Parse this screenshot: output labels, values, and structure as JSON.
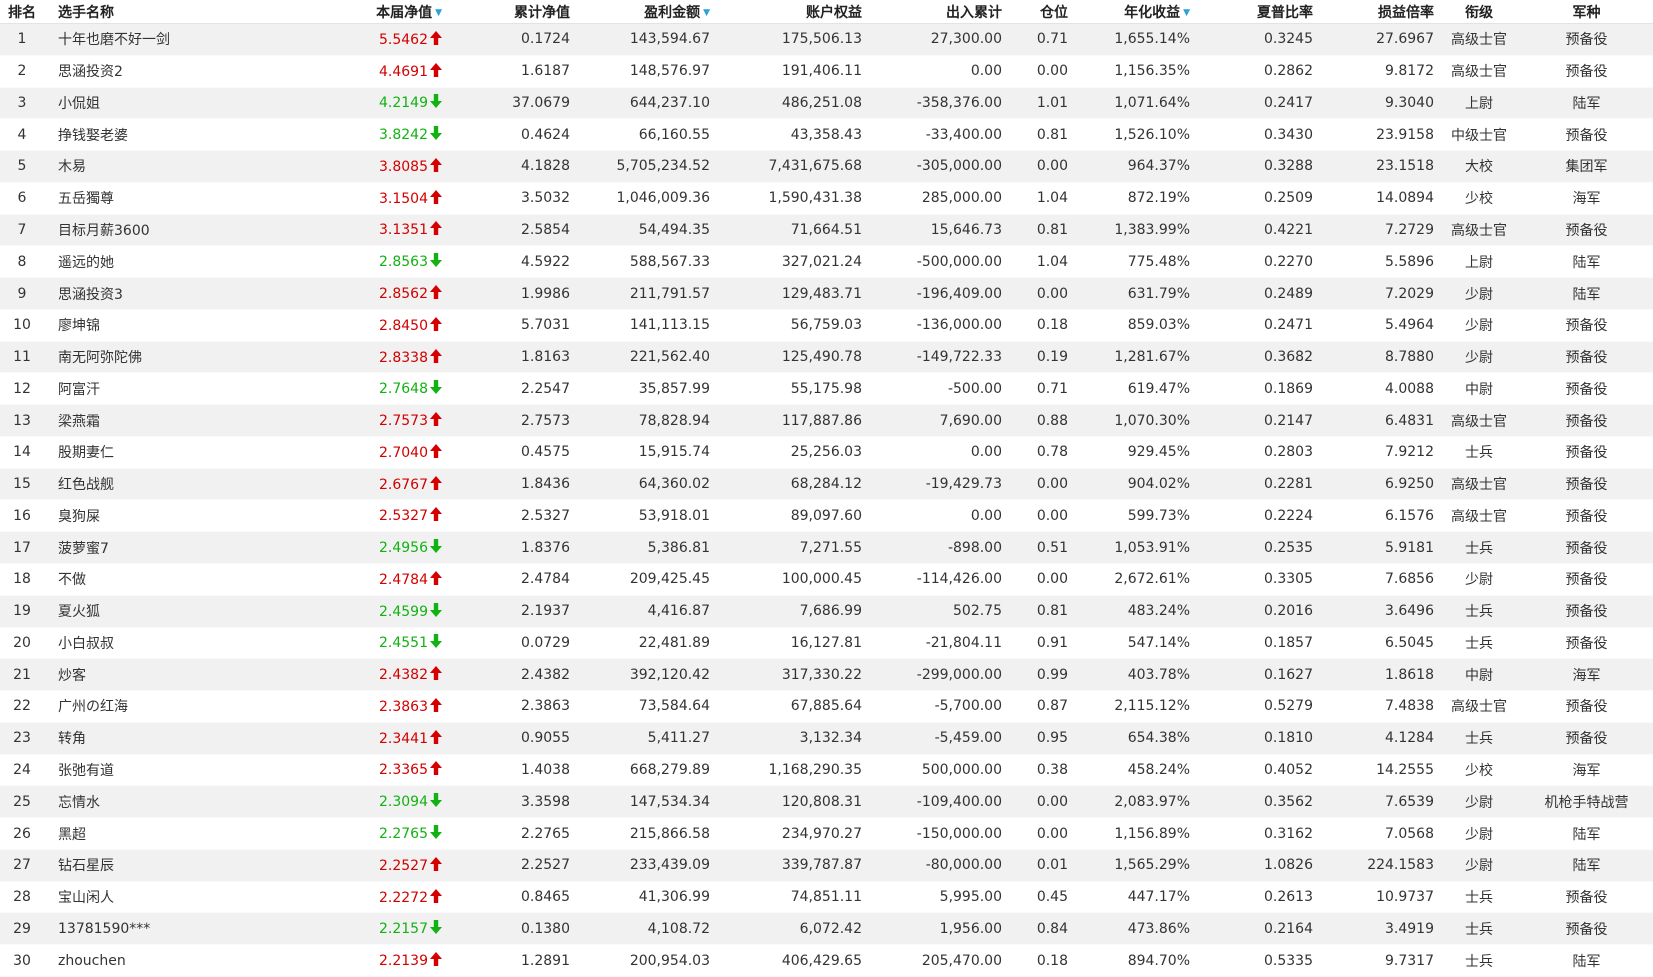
{
  "columns": {
    "rank": "排名",
    "name": "选手名称",
    "nav": "本届净值",
    "cum_nav": "累计净值",
    "profit": "盈利金额",
    "equity": "账户权益",
    "flow": "出入累计",
    "position": "仓位",
    "annual": "年化收益",
    "sharpe": "夏普比率",
    "pl_ratio": "损益倍率",
    "rank_title": "衔级",
    "army": "军种"
  },
  "sorted_columns": [
    "nav",
    "profit",
    "annual"
  ],
  "colors": {
    "up": "#d40000",
    "down": "#12b212",
    "sort": "#2aa0dc",
    "row_alt": "#f1f1f1"
  },
  "icons": {
    "up": "arrow-up-icon",
    "down": "arrow-down-icon",
    "sort": "sort-desc-icon"
  },
  "rows": [
    {
      "rank": "1",
      "name": "十年也磨不好一剑",
      "nav": "5.5462",
      "dir": "up",
      "cum_nav": "0.1724",
      "profit": "143,594.67",
      "equity": "175,506.13",
      "flow": "27,300.00",
      "position": "0.71",
      "annual": "1,655.14%",
      "sharpe": "0.3245",
      "pl_ratio": "27.6967",
      "rank_title": "高级士官",
      "army": "预备役"
    },
    {
      "rank": "2",
      "name": "思涵投资2",
      "nav": "4.4691",
      "dir": "up",
      "cum_nav": "1.6187",
      "profit": "148,576.97",
      "equity": "191,406.11",
      "flow": "0.00",
      "position": "0.00",
      "annual": "1,156.35%",
      "sharpe": "0.2862",
      "pl_ratio": "9.8172",
      "rank_title": "高级士官",
      "army": "预备役"
    },
    {
      "rank": "3",
      "name": "小侃姐",
      "nav": "4.2149",
      "dir": "down",
      "cum_nav": "37.0679",
      "profit": "644,237.10",
      "equity": "486,251.08",
      "flow": "-358,376.00",
      "position": "1.01",
      "annual": "1,071.64%",
      "sharpe": "0.2417",
      "pl_ratio": "9.3040",
      "rank_title": "上尉",
      "army": "陆军"
    },
    {
      "rank": "4",
      "name": "挣钱娶老婆",
      "nav": "3.8242",
      "dir": "down",
      "cum_nav": "0.4624",
      "profit": "66,160.55",
      "equity": "43,358.43",
      "flow": "-33,400.00",
      "position": "0.81",
      "annual": "1,526.10%",
      "sharpe": "0.3430",
      "pl_ratio": "23.9158",
      "rank_title": "中级士官",
      "army": "预备役"
    },
    {
      "rank": "5",
      "name": "木易",
      "nav": "3.8085",
      "dir": "up",
      "cum_nav": "4.1828",
      "profit": "5,705,234.52",
      "equity": "7,431,675.68",
      "flow": "-305,000.00",
      "position": "0.00",
      "annual": "964.37%",
      "sharpe": "0.3288",
      "pl_ratio": "23.1518",
      "rank_title": "大校",
      "army": "集团军"
    },
    {
      "rank": "6",
      "name": "五岳獨尊",
      "nav": "3.1504",
      "dir": "up",
      "cum_nav": "3.5032",
      "profit": "1,046,009.36",
      "equity": "1,590,431.38",
      "flow": "285,000.00",
      "position": "1.04",
      "annual": "872.19%",
      "sharpe": "0.2509",
      "pl_ratio": "14.0894",
      "rank_title": "少校",
      "army": "海军"
    },
    {
      "rank": "7",
      "name": "目标月薪3600",
      "nav": "3.1351",
      "dir": "up",
      "cum_nav": "2.5854",
      "profit": "54,494.35",
      "equity": "71,664.51",
      "flow": "15,646.73",
      "position": "0.81",
      "annual": "1,383.99%",
      "sharpe": "0.4221",
      "pl_ratio": "7.2729",
      "rank_title": "高级士官",
      "army": "预备役"
    },
    {
      "rank": "8",
      "name": "遥远的她",
      "nav": "2.8563",
      "dir": "down",
      "cum_nav": "4.5922",
      "profit": "588,567.33",
      "equity": "327,021.24",
      "flow": "-500,000.00",
      "position": "1.04",
      "annual": "775.48%",
      "sharpe": "0.2270",
      "pl_ratio": "5.5896",
      "rank_title": "上尉",
      "army": "陆军"
    },
    {
      "rank": "9",
      "name": "思涵投资3",
      "nav": "2.8562",
      "dir": "up",
      "cum_nav": "1.9986",
      "profit": "211,791.57",
      "equity": "129,483.71",
      "flow": "-196,409.00",
      "position": "0.00",
      "annual": "631.79%",
      "sharpe": "0.2489",
      "pl_ratio": "7.2029",
      "rank_title": "少尉",
      "army": "陆军"
    },
    {
      "rank": "10",
      "name": "廖坤锦",
      "nav": "2.8450",
      "dir": "up",
      "cum_nav": "5.7031",
      "profit": "141,113.15",
      "equity": "56,759.03",
      "flow": "-136,000.00",
      "position": "0.18",
      "annual": "859.03%",
      "sharpe": "0.2471",
      "pl_ratio": "5.4964",
      "rank_title": "少尉",
      "army": "预备役"
    },
    {
      "rank": "11",
      "name": "南无阿弥陀佛",
      "nav": "2.8338",
      "dir": "up",
      "cum_nav": "1.8163",
      "profit": "221,562.40",
      "equity": "125,490.78",
      "flow": "-149,722.33",
      "position": "0.19",
      "annual": "1,281.67%",
      "sharpe": "0.3682",
      "pl_ratio": "8.7880",
      "rank_title": "少尉",
      "army": "预备役"
    },
    {
      "rank": "12",
      "name": "阿富汗",
      "nav": "2.7648",
      "dir": "down",
      "cum_nav": "2.2547",
      "profit": "35,857.99",
      "equity": "55,175.98",
      "flow": "-500.00",
      "position": "0.71",
      "annual": "619.47%",
      "sharpe": "0.1869",
      "pl_ratio": "4.0088",
      "rank_title": "中尉",
      "army": "预备役"
    },
    {
      "rank": "13",
      "name": "梁燕霜",
      "nav": "2.7573",
      "dir": "up",
      "cum_nav": "2.7573",
      "profit": "78,828.94",
      "equity": "117,887.86",
      "flow": "7,690.00",
      "position": "0.88",
      "annual": "1,070.30%",
      "sharpe": "0.2147",
      "pl_ratio": "6.4831",
      "rank_title": "高级士官",
      "army": "预备役"
    },
    {
      "rank": "14",
      "name": "股期妻仁",
      "nav": "2.7040",
      "dir": "up",
      "cum_nav": "0.4575",
      "profit": "15,915.74",
      "equity": "25,256.03",
      "flow": "0.00",
      "position": "0.78",
      "annual": "929.45%",
      "sharpe": "0.2803",
      "pl_ratio": "7.9212",
      "rank_title": "士兵",
      "army": "预备役"
    },
    {
      "rank": "15",
      "name": "红色战舰",
      "nav": "2.6767",
      "dir": "up",
      "cum_nav": "1.8436",
      "profit": "64,360.02",
      "equity": "68,284.12",
      "flow": "-19,429.73",
      "position": "0.00",
      "annual": "904.02%",
      "sharpe": "0.2281",
      "pl_ratio": "6.9250",
      "rank_title": "高级士官",
      "army": "预备役"
    },
    {
      "rank": "16",
      "name": "臭狗屎",
      "nav": "2.5327",
      "dir": "up",
      "cum_nav": "2.5327",
      "profit": "53,918.01",
      "equity": "89,097.60",
      "flow": "0.00",
      "position": "0.00",
      "annual": "599.73%",
      "sharpe": "0.2224",
      "pl_ratio": "6.1576",
      "rank_title": "高级士官",
      "army": "预备役"
    },
    {
      "rank": "17",
      "name": "菠萝蜜7",
      "nav": "2.4956",
      "dir": "down",
      "cum_nav": "1.8376",
      "profit": "5,386.81",
      "equity": "7,271.55",
      "flow": "-898.00",
      "position": "0.51",
      "annual": "1,053.91%",
      "sharpe": "0.2535",
      "pl_ratio": "5.9181",
      "rank_title": "士兵",
      "army": "预备役"
    },
    {
      "rank": "18",
      "name": "不做",
      "nav": "2.4784",
      "dir": "up",
      "cum_nav": "2.4784",
      "profit": "209,425.45",
      "equity": "100,000.45",
      "flow": "-114,426.00",
      "position": "0.00",
      "annual": "2,672.61%",
      "sharpe": "0.3305",
      "pl_ratio": "7.6856",
      "rank_title": "少尉",
      "army": "预备役"
    },
    {
      "rank": "19",
      "name": "夏火狐",
      "nav": "2.4599",
      "dir": "down",
      "cum_nav": "2.1937",
      "profit": "4,416.87",
      "equity": "7,686.99",
      "flow": "502.75",
      "position": "0.81",
      "annual": "483.24%",
      "sharpe": "0.2016",
      "pl_ratio": "3.6496",
      "rank_title": "士兵",
      "army": "预备役"
    },
    {
      "rank": "20",
      "name": "小白叔叔",
      "nav": "2.4551",
      "dir": "down",
      "cum_nav": "0.0729",
      "profit": "22,481.89",
      "equity": "16,127.81",
      "flow": "-21,804.11",
      "position": "0.91",
      "annual": "547.14%",
      "sharpe": "0.1857",
      "pl_ratio": "6.5045",
      "rank_title": "士兵",
      "army": "预备役"
    },
    {
      "rank": "21",
      "name": "炒客",
      "nav": "2.4382",
      "dir": "up",
      "cum_nav": "2.4382",
      "profit": "392,120.42",
      "equity": "317,330.22",
      "flow": "-299,000.00",
      "position": "0.99",
      "annual": "403.78%",
      "sharpe": "0.1627",
      "pl_ratio": "1.8618",
      "rank_title": "中尉",
      "army": "海军"
    },
    {
      "rank": "22",
      "name": "广州の红海",
      "nav": "2.3863",
      "dir": "up",
      "cum_nav": "2.3863",
      "profit": "73,584.64",
      "equity": "67,885.64",
      "flow": "-5,700.00",
      "position": "0.87",
      "annual": "2,115.12%",
      "sharpe": "0.5279",
      "pl_ratio": "7.4838",
      "rank_title": "高级士官",
      "army": "预备役"
    },
    {
      "rank": "23",
      "name": "转角",
      "nav": "2.3441",
      "dir": "up",
      "cum_nav": "0.9055",
      "profit": "5,411.27",
      "equity": "3,132.34",
      "flow": "-5,459.00",
      "position": "0.95",
      "annual": "654.38%",
      "sharpe": "0.1810",
      "pl_ratio": "4.1284",
      "rank_title": "士兵",
      "army": "预备役"
    },
    {
      "rank": "24",
      "name": "张弛有道",
      "nav": "2.3365",
      "dir": "up",
      "cum_nav": "1.4038",
      "profit": "668,279.89",
      "equity": "1,168,290.35",
      "flow": "500,000.00",
      "position": "0.38",
      "annual": "458.24%",
      "sharpe": "0.4052",
      "pl_ratio": "14.2555",
      "rank_title": "少校",
      "army": "海军"
    },
    {
      "rank": "25",
      "name": "忘情水",
      "nav": "2.3094",
      "dir": "down",
      "cum_nav": "3.3598",
      "profit": "147,534.34",
      "equity": "120,808.31",
      "flow": "-109,400.00",
      "position": "0.00",
      "annual": "2,083.97%",
      "sharpe": "0.3562",
      "pl_ratio": "7.6539",
      "rank_title": "少尉",
      "army": "机枪手特战营"
    },
    {
      "rank": "26",
      "name": "黑超",
      "nav": "2.2765",
      "dir": "down",
      "cum_nav": "2.2765",
      "profit": "215,866.58",
      "equity": "234,970.27",
      "flow": "-150,000.00",
      "position": "0.00",
      "annual": "1,156.89%",
      "sharpe": "0.3162",
      "pl_ratio": "7.0568",
      "rank_title": "少尉",
      "army": "陆军"
    },
    {
      "rank": "27",
      "name": "钻石星辰",
      "nav": "2.2527",
      "dir": "up",
      "cum_nav": "2.2527",
      "profit": "233,439.09",
      "equity": "339,787.87",
      "flow": "-80,000.00",
      "position": "0.01",
      "annual": "1,565.29%",
      "sharpe": "1.0826",
      "pl_ratio": "224.1583",
      "rank_title": "少尉",
      "army": "陆军"
    },
    {
      "rank": "28",
      "name": "宝山闲人",
      "nav": "2.2272",
      "dir": "up",
      "cum_nav": "0.8465",
      "profit": "41,306.99",
      "equity": "74,851.11",
      "flow": "5,995.00",
      "position": "0.45",
      "annual": "447.17%",
      "sharpe": "0.2613",
      "pl_ratio": "10.9737",
      "rank_title": "士兵",
      "army": "预备役"
    },
    {
      "rank": "29",
      "name": "13781590***",
      "nav": "2.2157",
      "dir": "down",
      "cum_nav": "0.1380",
      "profit": "4,108.72",
      "equity": "6,072.42",
      "flow": "1,956.00",
      "position": "0.84",
      "annual": "473.86%",
      "sharpe": "0.2164",
      "pl_ratio": "3.4919",
      "rank_title": "士兵",
      "army": "预备役"
    },
    {
      "rank": "30",
      "name": "zhouchen",
      "nav": "2.2139",
      "dir": "up",
      "cum_nav": "1.2891",
      "profit": "200,954.03",
      "equity": "406,429.65",
      "flow": "205,470.00",
      "position": "0.18",
      "annual": "894.70%",
      "sharpe": "0.5335",
      "pl_ratio": "9.7317",
      "rank_title": "士兵",
      "army": "陆军"
    }
  ]
}
